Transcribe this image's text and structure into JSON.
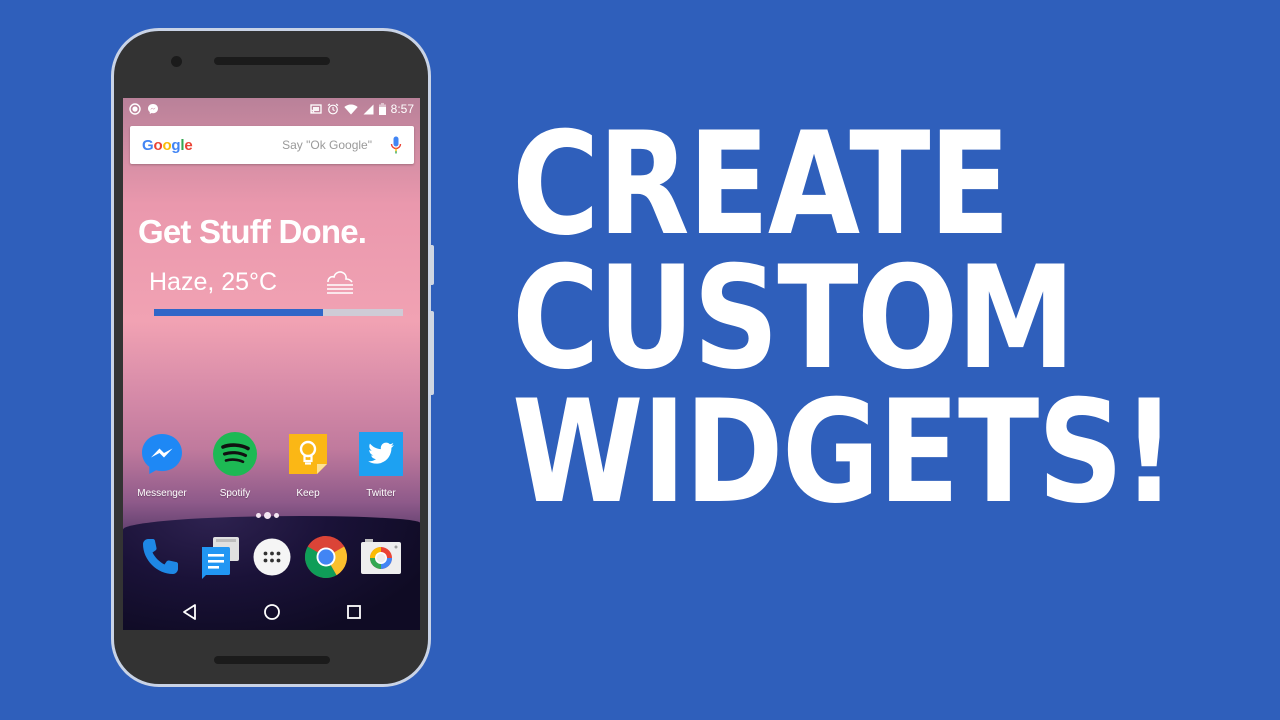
{
  "background_color": "#2f5fbb",
  "headline": {
    "lines": [
      "CREATE",
      "CUSTOM",
      "WIDGETS!"
    ]
  },
  "phone": {
    "statusbar": {
      "left_icons": [
        "record-icon",
        "messenger-notification-icon"
      ],
      "right_icons": [
        "cast-icon",
        "alarm-icon",
        "wifi-icon",
        "signal-icon",
        "battery-icon"
      ],
      "time": "8:57"
    },
    "search": {
      "logo": [
        "G",
        "o",
        "o",
        "g",
        "l",
        "e"
      ],
      "logo_colors": [
        "#4285f4",
        "#ea4335",
        "#fbbc05",
        "#4285f4",
        "#34a853",
        "#ea4335"
      ],
      "placeholder": "Say \"Ok Google\"",
      "mic_icon": "mic-icon"
    },
    "widget": {
      "title": "Get Stuff Done.",
      "weather": "Haze, 25°C",
      "weather_icon": "haze-icon",
      "progress_percent": 68,
      "progress_color": "#3066c8"
    },
    "apps": [
      {
        "label": "Messenger",
        "icon": "messenger-icon",
        "color": "#1e88f5"
      },
      {
        "label": "Spotify",
        "icon": "spotify-icon",
        "color": "#1db954"
      },
      {
        "label": "Keep",
        "icon": "keep-icon",
        "color": "#fbb715"
      },
      {
        "label": "Twitter",
        "icon": "twitter-icon",
        "color": "#1da1f2"
      }
    ],
    "page_indicator": {
      "count": 3,
      "active": 1
    },
    "dock": [
      {
        "name": "Phone",
        "icon": "phone-icon"
      },
      {
        "name": "Messages",
        "icon": "messages-icon"
      },
      {
        "name": "App drawer",
        "icon": "app-drawer-icon"
      },
      {
        "name": "Chrome",
        "icon": "chrome-icon"
      },
      {
        "name": "Camera",
        "icon": "camera-icon"
      }
    ],
    "navbar": [
      "back-icon",
      "home-icon",
      "recents-icon"
    ]
  }
}
